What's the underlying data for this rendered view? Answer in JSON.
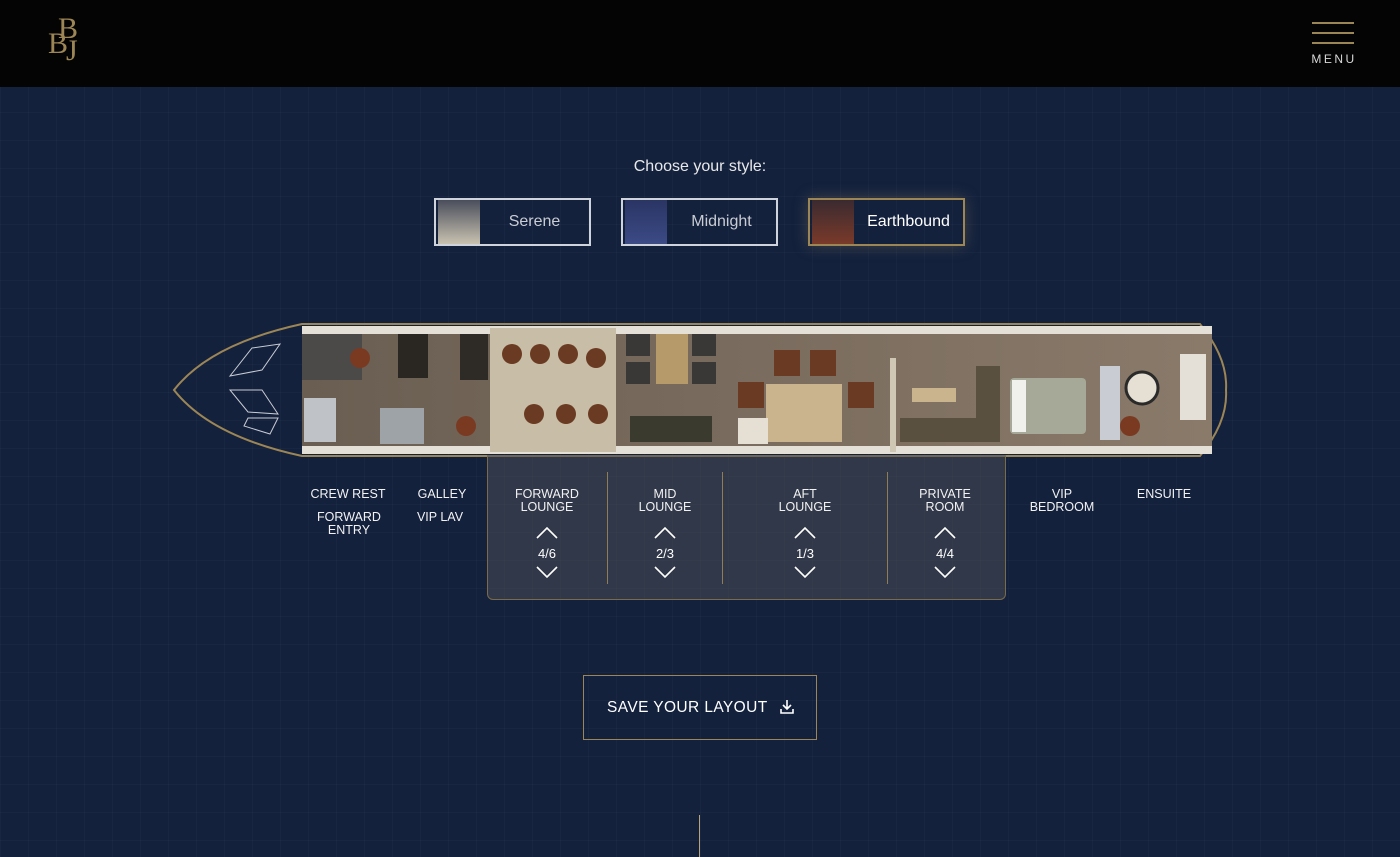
{
  "header": {
    "logo_letters": [
      "B",
      "B",
      "J"
    ],
    "menu_label": "MENU"
  },
  "style_picker": {
    "prompt": "Choose your style:",
    "options": [
      {
        "label": "Serene",
        "swatch_from": "#4a4e5c",
        "swatch_to": "#c9c2b0",
        "selected": false
      },
      {
        "label": "Midnight",
        "swatch_from": "#2a3564",
        "swatch_to": "#3c4a86",
        "selected": false
      },
      {
        "label": "Earthbound",
        "swatch_from": "#3a2a30",
        "swatch_to": "#7a3a2a",
        "selected": true
      }
    ]
  },
  "zones": {
    "crew_rest": "CREW REST",
    "forward_entry": "FORWARD ENTRY",
    "galley": "GALLEY",
    "vip_lav": "VIP LAV",
    "forward_lounge": {
      "label": "FORWARD LOUNGE",
      "counter": "4/6"
    },
    "mid_lounge": {
      "label": "MID LOUNGE",
      "counter": "2/3"
    },
    "aft_lounge": {
      "label": "AFT LOUNGE",
      "counter": "1/3"
    },
    "private_room": {
      "label": "PRIVATE ROOM",
      "counter": "4/4"
    },
    "vip_bedroom": "VIP BEDROOM",
    "ensuite": "ENSUITE"
  },
  "save_button": {
    "label": "SAVE YOUR LAYOUT"
  },
  "colors": {
    "background": "#13213d",
    "header": "#040404",
    "gold_accent": "#9d8655"
  }
}
